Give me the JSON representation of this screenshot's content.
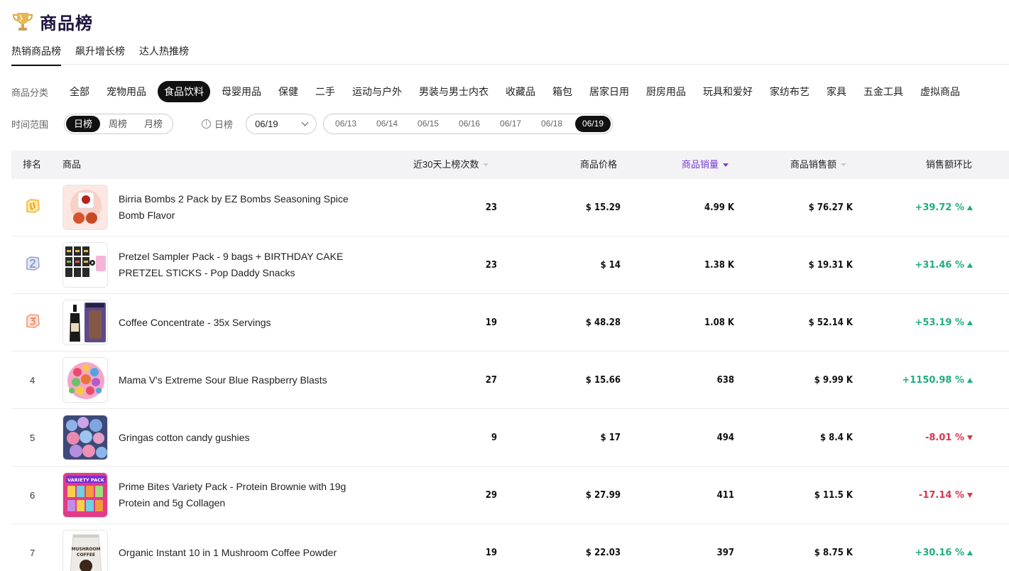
{
  "page": {
    "title": "商品榜"
  },
  "tabs": [
    {
      "label": "热销商品榜",
      "active": true
    },
    {
      "label": "飙升增长榜",
      "active": false
    },
    {
      "label": "达人热推榜",
      "active": false
    }
  ],
  "filters": {
    "category_label": "商品分类",
    "categories": [
      "全部",
      "宠物用品",
      "食品饮料",
      "母婴用品",
      "保健",
      "二手",
      "运动与户外",
      "男装与男士内衣",
      "收藏品",
      "箱包",
      "居家日用",
      "厨房用品",
      "玩具和爱好",
      "家纺布艺",
      "家具",
      "五金工具",
      "虚拟商品"
    ],
    "active_category": "食品饮料",
    "time_label": "时间范围",
    "time_options": [
      "日榜",
      "周榜",
      "月榜"
    ],
    "active_time": "日榜",
    "info_text": "日榜",
    "date_select_value": "06/19",
    "dates": [
      "06/13",
      "06/14",
      "06/15",
      "06/16",
      "06/17",
      "06/18",
      "06/19"
    ],
    "active_date": "06/19"
  },
  "table": {
    "headers": {
      "rank": "排名",
      "product": "商品",
      "appearances": "近30天上榜次数",
      "price": "商品价格",
      "sales": "商品销量",
      "revenue": "商品销售额",
      "change": "销售额环比"
    },
    "rows": [
      {
        "rank": "1",
        "medal": "gold",
        "name": "Birria Bombs 2 Pack by EZ Bombs Seasoning Spice Bomb Flavor",
        "appearances": "23",
        "price": "$ 15.29",
        "sales": "4.99 K",
        "revenue": "$ 76.27 K",
        "change": "+39.72 %",
        "trend": "up",
        "thumb": "birria-bombs"
      },
      {
        "rank": "2",
        "medal": "silver",
        "name": "Pretzel Sampler Pack - 9 bags + BIRTHDAY CAKE PRETZEL STICKS - Pop Daddy Snacks",
        "appearances": "23",
        "price": "$ 14",
        "sales": "1.38 K",
        "revenue": "$ 19.31 K",
        "change": "+31.46 %",
        "trend": "up",
        "thumb": "pretzel-pack"
      },
      {
        "rank": "3",
        "medal": "bronze",
        "name": "Coffee Concentrate - 35x Servings",
        "appearances": "19",
        "price": "$ 48.28",
        "sales": "1.08 K",
        "revenue": "$ 52.14 K",
        "change": "+53.19 %",
        "trend": "up",
        "thumb": "coffee-concentrate"
      },
      {
        "rank": "4",
        "medal": "",
        "name": "Mama V's Extreme Sour Blue Raspberry Blasts",
        "appearances": "27",
        "price": "$ 15.66",
        "sales": "638",
        "revenue": "$ 9.99 K",
        "change": "+1150.98 %",
        "trend": "up",
        "thumb": "sour-candy"
      },
      {
        "rank": "5",
        "medal": "",
        "name": "Gringas cotton candy gushies",
        "appearances": "9",
        "price": "$ 17",
        "sales": "494",
        "revenue": "$ 8.4 K",
        "change": "-8.01 %",
        "trend": "down",
        "thumb": "gushies"
      },
      {
        "rank": "6",
        "medal": "",
        "name": "Prime Bites Variety Pack - Protein Brownie with 19g Protein and 5g Collagen",
        "appearances": "29",
        "price": "$ 27.99",
        "sales": "411",
        "revenue": "$ 11.5 K",
        "change": "-17.14 %",
        "trend": "down",
        "thumb": "prime-bites"
      },
      {
        "rank": "7",
        "medal": "",
        "name": "Organic Instant 10 in 1 Mushroom Coffee Powder",
        "appearances": "19",
        "price": "$ 22.03",
        "sales": "397",
        "revenue": "$ 8.75 K",
        "change": "+30.16 %",
        "trend": "up",
        "thumb": "mushroom-coffee"
      }
    ]
  },
  "colors": {
    "accent": "#7b3fd1",
    "up": "#1fae7c",
    "down": "#d8354d",
    "gold": "#f2c14e",
    "silver": "#a7b3d9",
    "bronze": "#f0a58a"
  },
  "thumb_labels": {
    "variety": "VARIETY PACK",
    "mushroom": "MUSHROOM",
    "coffee": "COFFEE"
  }
}
